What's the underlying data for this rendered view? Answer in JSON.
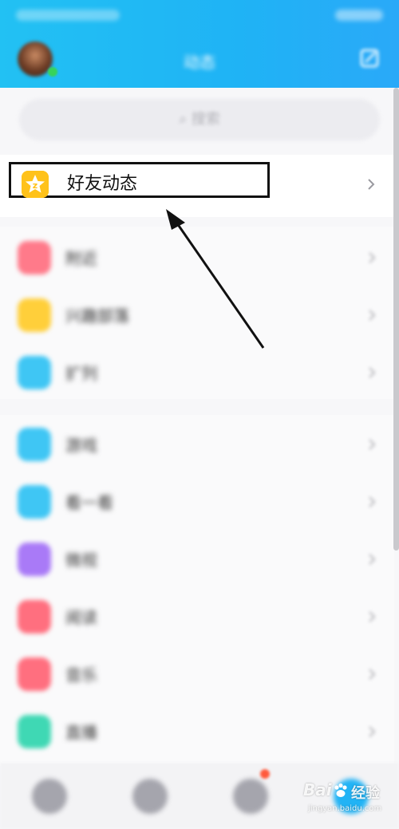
{
  "header": {
    "title": "动态",
    "avatar_icon": "user-avatar-icon",
    "edit_icon": "edit-icon",
    "accent_color": "#22c1f3"
  },
  "search": {
    "placeholder": "搜索",
    "icon": "search-icon"
  },
  "feed_entry": {
    "label": "好友动态",
    "icon": "qzone-star-icon",
    "icon_color": "#ffc21a"
  },
  "group1": {
    "items": [
      {
        "label": "附近",
        "icon": "location-icon",
        "color": "#ff7a8a"
      },
      {
        "label": "兴趣部落",
        "icon": "tribe-icon",
        "color": "#ffcf3a"
      },
      {
        "label": "扩列",
        "icon": "friends-icon",
        "color": "#3fc6f4"
      }
    ]
  },
  "group2": {
    "items": [
      {
        "label": "游戏",
        "icon": "game-icon",
        "color": "#3fc6f4"
      },
      {
        "label": "看一看",
        "icon": "view-icon",
        "color": "#3fc6f4"
      },
      {
        "label": "微视",
        "icon": "video-icon",
        "color": "#a97af7"
      },
      {
        "label": "阅读",
        "icon": "book-icon",
        "color": "#ff6f7f"
      },
      {
        "label": "音乐",
        "icon": "music-icon",
        "color": "#ff6f7f"
      },
      {
        "label": "直播",
        "icon": "live-icon",
        "color": "#3fd8b4"
      }
    ]
  },
  "tabbar": {
    "tabs": [
      {
        "name": "messages-tab-icon",
        "color": "#a5a5ad"
      },
      {
        "name": "contacts-tab-icon",
        "color": "#a5a5ad"
      },
      {
        "name": "watch-tab-icon",
        "color": "#a5a5ad"
      },
      {
        "name": "feeds-tab-icon",
        "color": "#21b3f5"
      }
    ]
  },
  "annotation": {
    "highlight_color": "#111111"
  },
  "watermark": {
    "brand": "Bai",
    "suffix": "经验",
    "url": "jingyan.baidu.com"
  }
}
